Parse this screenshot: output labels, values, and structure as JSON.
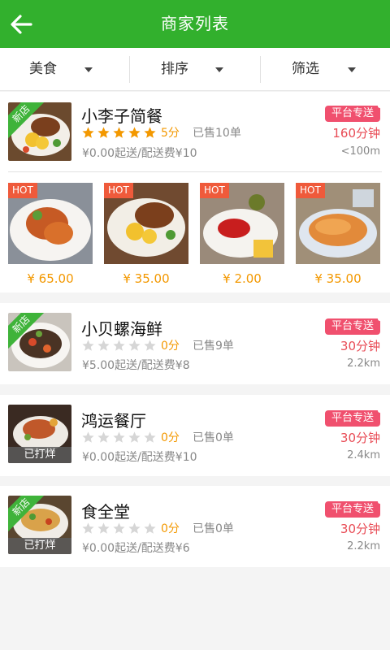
{
  "header": {
    "title": "商家列表",
    "back_icon": "arrow-left-icon"
  },
  "filters": [
    {
      "label": "美食"
    },
    {
      "label": "排序"
    },
    {
      "label": "筛选"
    }
  ],
  "colors": {
    "brand": "#32b02d",
    "price": "#f39800",
    "tag": "#f0506e",
    "time": "#e84b55"
  },
  "shops": [
    {
      "name": "小李子简餐",
      "score": "5分",
      "stars": 5,
      "sold": "已售10单",
      "delivery": "¥0.00起送/配送费¥10",
      "tag": "平台专送",
      "time": "160分钟",
      "distance": "<100m",
      "badge": "新店"
    },
    {
      "name": "小贝螺海鲜",
      "score": "0分",
      "stars": 0,
      "sold": "已售9单",
      "delivery": "¥5.00起送/配送费¥8",
      "tag": "平台专送",
      "time": "30分钟",
      "distance": "2.2km",
      "badge": "新店"
    },
    {
      "name": "鸿运餐厅",
      "score": "0分",
      "stars": 0,
      "sold": "已售0单",
      "delivery": "¥0.00起送/配送费¥10",
      "tag": "平台专送",
      "time": "30分钟",
      "distance": "2.4km",
      "status": "已打烊"
    },
    {
      "name": "食全堂",
      "score": "0分",
      "stars": 0,
      "sold": "已售0单",
      "delivery": "¥0.00起送/配送费¥6",
      "tag": "平台专送",
      "time": "30分钟",
      "distance": "2.2km",
      "badge": "新店",
      "status": "已打烊"
    }
  ],
  "dishes": [
    {
      "tag": "HOT",
      "price": "¥ 65.00"
    },
    {
      "tag": "HOT",
      "price": "¥ 35.00"
    },
    {
      "tag": "HOT",
      "price": "¥ 2.00"
    },
    {
      "tag": "HOT",
      "price": "¥ 35.00"
    }
  ]
}
